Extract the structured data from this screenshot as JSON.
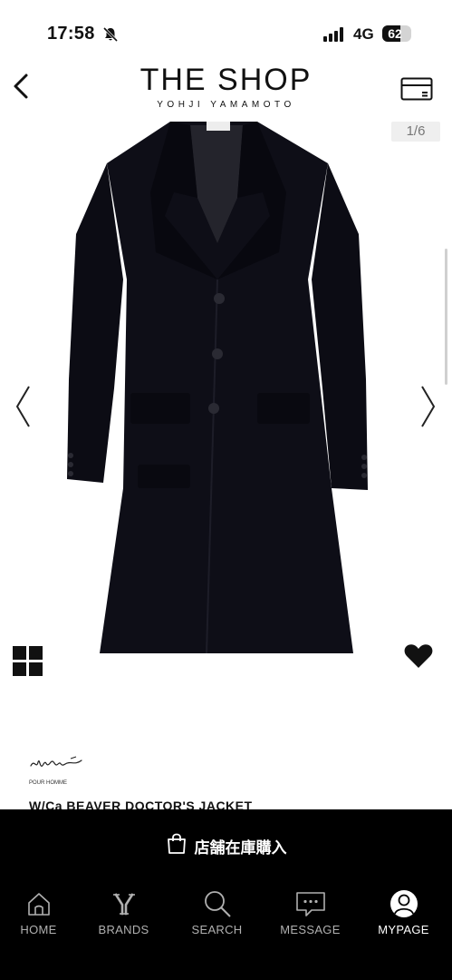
{
  "status": {
    "time": "17:58",
    "network": "4G",
    "battery": "62",
    "battery_level": 0.62
  },
  "header": {
    "logo_title": "THE SHOP",
    "logo_subtitle": "YOHJI YAMAMOTO"
  },
  "gallery": {
    "counter": "1/6"
  },
  "product": {
    "brand_sub": "POUR HOMME",
    "title": "W/Ca BEAVER DOCTOR'S JACKET"
  },
  "buy": {
    "label": "店舗在庫購入"
  },
  "tabs": [
    {
      "label": "HOME",
      "icon": "home-icon"
    },
    {
      "label": "BRANDS",
      "icon": "y-letter-icon"
    },
    {
      "label": "SEARCH",
      "icon": "search-icon"
    },
    {
      "label": "MESSAGE",
      "icon": "message-icon"
    },
    {
      "label": "MYPAGE",
      "icon": "user-icon",
      "active": true
    }
  ]
}
